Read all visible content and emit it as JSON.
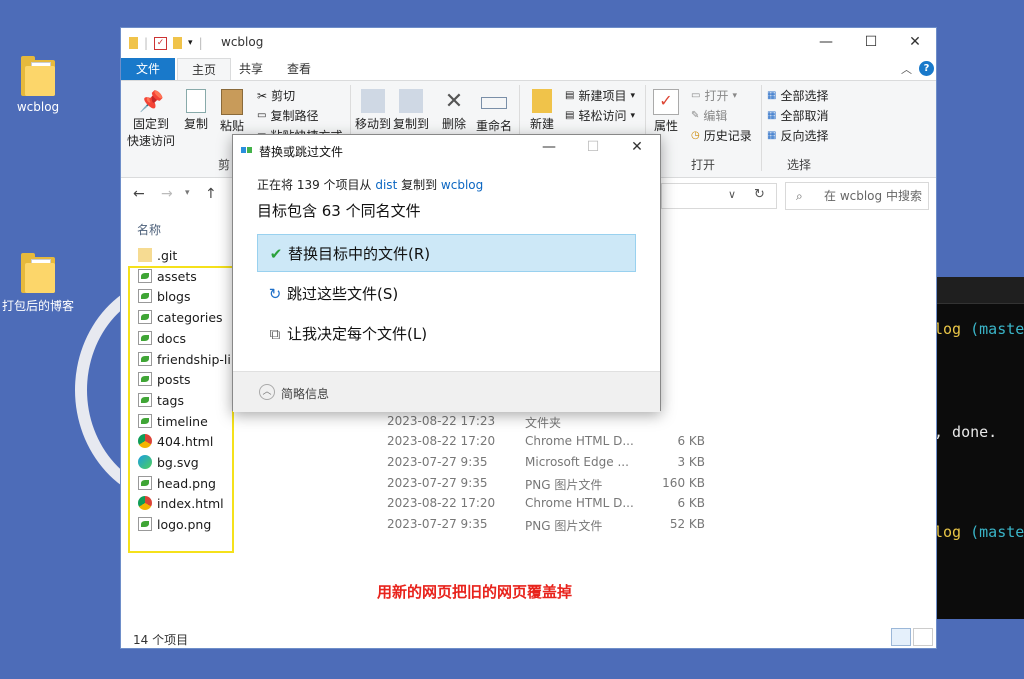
{
  "desktop": {
    "icons": [
      {
        "label": "wcblog"
      },
      {
        "label": "打包后的博客"
      }
    ]
  },
  "terminal": {
    "line1_dir": "log",
    "line1_branch": "(maste",
    "line2": ", done.",
    "line3_dir": "log",
    "line3_branch": "(maste"
  },
  "explorer": {
    "title": "wcblog",
    "window_controls": {
      "minimize": "—",
      "maximize": "☐",
      "close": "✕"
    },
    "tabs": {
      "file": "文件",
      "home": "主页",
      "share": "共享",
      "view": "查看"
    },
    "ribbon": {
      "pin": "固定到\n快速访问",
      "pin_l1": "固定到",
      "pin_l2": "快速访问",
      "copy": "复制",
      "paste": "粘贴",
      "cut": "剪切",
      "copy_path": "复制路径",
      "paste_shortcut": "粘贴快捷方式",
      "clipboard_group": "剪",
      "move_to": "移动到",
      "copy_to": "复制到",
      "delete": "删除",
      "rename": "重命名",
      "new_folder": "新建",
      "new_item": "新建项目",
      "easy_access": "轻松访问",
      "properties": "属性",
      "open": "打开",
      "edit": "编辑",
      "history": "历史记录",
      "open_group": "打开",
      "select_all": "全部选择",
      "select_none": "全部取消",
      "invert": "反向选择",
      "select_group": "选择"
    },
    "search_placeholder": "在 wcblog 中搜索",
    "column_name": "名称",
    "files": [
      {
        "name": ".git",
        "date": "",
        "type": "",
        "size": "",
        "icon": "folder-git-icon"
      },
      {
        "name": "assets",
        "date": "",
        "type": "",
        "size": "",
        "icon": "folder-icon"
      },
      {
        "name": "blogs",
        "date": "",
        "type": "",
        "size": "",
        "icon": "folder-icon"
      },
      {
        "name": "categories",
        "date": "",
        "type": "",
        "size": "",
        "icon": "folder-icon"
      },
      {
        "name": "docs",
        "date": "",
        "type": "",
        "size": "",
        "icon": "folder-icon"
      },
      {
        "name": "friendship-lin",
        "date": "",
        "type": "",
        "size": "",
        "icon": "folder-icon"
      },
      {
        "name": "posts",
        "date": "",
        "type": "",
        "size": "",
        "icon": "folder-icon"
      },
      {
        "name": "tags",
        "date": "",
        "type": "",
        "size": "",
        "icon": "folder-icon"
      },
      {
        "name": "timeline",
        "date": "2023-08-22 17:23",
        "type": "文件夹",
        "size": "",
        "icon": "folder-icon"
      },
      {
        "name": "404.html",
        "date": "2023-08-22 17:20",
        "type": "Chrome HTML D...",
        "size": "6 KB",
        "icon": "chrome-icon"
      },
      {
        "name": "bg.svg",
        "date": "2023-07-27 9:35",
        "type": "Microsoft Edge ...",
        "size": "3 KB",
        "icon": "edge-icon"
      },
      {
        "name": "head.png",
        "date": "2023-07-27 9:35",
        "type": "PNG 图片文件",
        "size": "160 KB",
        "icon": "image-icon"
      },
      {
        "name": "index.html",
        "date": "2023-08-22 17:20",
        "type": "Chrome HTML D...",
        "size": "6 KB",
        "icon": "chrome-icon"
      },
      {
        "name": "logo.png",
        "date": "2023-07-27 9:35",
        "type": "PNG 图片文件",
        "size": "52 KB",
        "icon": "image-icon"
      }
    ],
    "annotation": "用新的网页把旧的网页覆盖掉",
    "status": "14 个项目"
  },
  "dialog": {
    "title": "替换或跳过文件",
    "sub_prefix": "正在将 139 个项目从 ",
    "sub_src": "dist",
    "sub_mid": " 复制到 ",
    "sub_dst": "wcblog",
    "heading": "目标包含 63 个同名文件",
    "options": [
      {
        "icon": "✔",
        "label": "替换目标中的文件(R)"
      },
      {
        "icon": "↻",
        "label": "跳过这些文件(S)"
      },
      {
        "icon": "⧉",
        "label": "让我决定每个文件(L)"
      }
    ],
    "details": "简略信息",
    "window_controls": {
      "minimize": "—",
      "maximize": "☐",
      "close": "✕"
    }
  },
  "colors": {
    "accent": "#1979ca",
    "desktop": "#4d6cb8",
    "highlight": "#f5e11b",
    "annotation": "#e8231c",
    "selection": "#cde8f7"
  }
}
